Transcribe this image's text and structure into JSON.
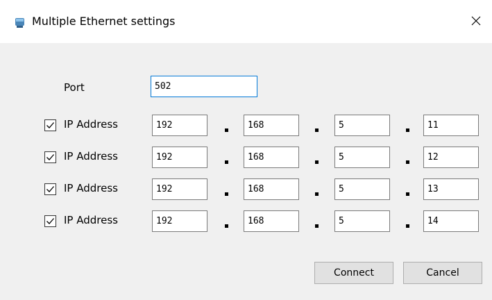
{
  "window": {
    "title": "Multiple Ethernet settings"
  },
  "port": {
    "label": "Port",
    "value": "502"
  },
  "rows": [
    {
      "checked": true,
      "label": "IP Address",
      "octets": [
        "192",
        "168",
        "5",
        "11"
      ]
    },
    {
      "checked": true,
      "label": "IP Address",
      "octets": [
        "192",
        "168",
        "5",
        "12"
      ]
    },
    {
      "checked": true,
      "label": "IP Address",
      "octets": [
        "192",
        "168",
        "5",
        "13"
      ]
    },
    {
      "checked": true,
      "label": "IP Address",
      "octets": [
        "192",
        "168",
        "5",
        "14"
      ]
    }
  ],
  "buttons": {
    "connect": "Connect",
    "cancel": "Cancel"
  },
  "icons": {
    "app": "network-device-icon",
    "close": "close-icon",
    "check": "checkmark-icon"
  },
  "colors": {
    "focus_border": "#0078d7",
    "field_border": "#7a7a7a",
    "button_bg": "#e1e1e1"
  }
}
